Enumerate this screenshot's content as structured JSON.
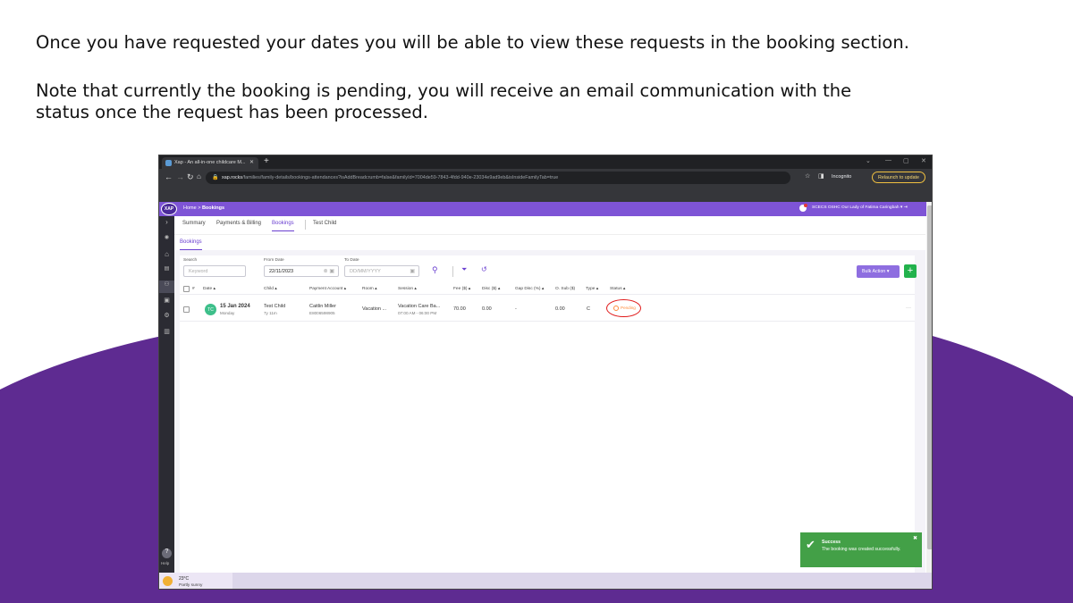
{
  "slide": {
    "line1": "Once you have requested your dates you will be able to view these requests in the booking section.",
    "line2": "Note that currently the booking is pending, you will receive an email communication with the status once the request has been processed."
  },
  "browser": {
    "tab_title": "Xap - An all-in-one childcare M...",
    "url_host": "xap.rocks",
    "url_path": "/families/family-details/bookings-attendances?isAddBreadcrumb=false&familyId=7004de59-7843-4fdd-940e-23034e9ad9eb&isInsideFamilyTab=true",
    "incognito_label": "Incognito",
    "relaunch_label": "Relaunch to update"
  },
  "app": {
    "logo_text": "XAP",
    "crumb_home": "Home",
    "crumb_sep": " > ",
    "crumb_current": "Bookings",
    "centre_name": "SCECS OSHC Our Lady of Fatima Caringbah",
    "help_label": "Help"
  },
  "tabs": [
    "Summary",
    "Payments & Billing",
    "Bookings",
    "Test Child"
  ],
  "bookings": {
    "tab_label": "Bookings"
  },
  "filters": {
    "search_label": "Search",
    "search_placeholder": "Keyword",
    "from_label": "From Date",
    "from_value": "22/11/2023",
    "to_label": "To Date",
    "to_placeholder": "DD/MM/YYYY"
  },
  "actions": {
    "bulk_label": "Bulk Action",
    "add_label": "+"
  },
  "table": {
    "headers": [
      "#",
      "Date ▴",
      "Child ▴",
      "Payment Account ▴",
      "Room ▴",
      "Session ▴",
      "Fee ($) ▴",
      "Disc ($) ▴",
      "Gap Disc (%) ▴",
      "O. Sub ($)",
      "Type ▴",
      "Status ▴"
    ],
    "rows": [
      {
        "initials": "TC",
        "date": "15 Jan 2024",
        "day": "Monday",
        "child": "Test Child",
        "age": "7y 11m",
        "account": "Caitlin Miller",
        "account_id": "E8006598905",
        "room": "Vacation ...",
        "session": "Vacation Care Ba...",
        "time": "07:00 AM - 06:00 PM",
        "fee": "70.00",
        "disc": "0.00",
        "gap_disc": "-",
        "o_sub": "0.00",
        "type": "C",
        "status": "Pending"
      }
    ]
  },
  "toast": {
    "title": "Success",
    "message": "The booking was created successfully."
  },
  "taskbar": {
    "temperature": "23°C",
    "condition": "Partly sunny"
  }
}
